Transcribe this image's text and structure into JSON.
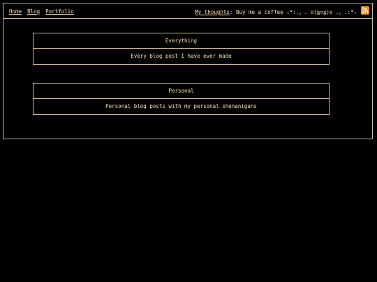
{
  "nav": {
    "home": "Home",
    "blog": "Blog",
    "portfolio": "Portfolio"
  },
  "thoughts": {
    "link": "My thoughts",
    "text": ": Buy me a coffee ☆*:.。. o(≧▽≦)o .。.:*☆"
  },
  "rss_icon": "rss-feed-icon",
  "colors": {
    "background": "#000000",
    "text": "#ffdfb4",
    "border": "#c9b79c",
    "rss": "#e8902a"
  },
  "cards": [
    {
      "title": "Everything",
      "description": "Every blog post I have ever made"
    },
    {
      "title": "Personal",
      "description": "Personal blog posts with my personal shenanigans"
    }
  ]
}
